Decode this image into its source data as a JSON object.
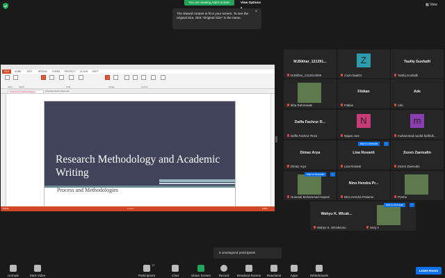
{
  "topbar": {
    "viewing": "You are viewing Ade's screen",
    "view_options": "View Options ▾",
    "view": "View",
    "notice": "The shared content is fit to your screen. To see the original size, click \"Original Size\" in the menu."
  },
  "shared": {
    "file_tab": "FILE",
    "menu_tabs": [
      "HOME",
      "EDIT",
      "REVIEW",
      "FORMS",
      "PROTECT",
      "CLOUD",
      "HELP"
    ],
    "ribbon_groups": [
      "Hand",
      "Select",
      "Tools",
      "Create",
      "Convert"
    ],
    "active_tab": "Process and Methodologies",
    "other_tab": "Shooting Flows Statement",
    "slide_title": "Research Methodology and Academic Writing",
    "slide_subtitle": "Process and Methodologies",
    "status_left": "8.5x11",
    "status_page": "1 of 14",
    "status_zoom": "100%"
  },
  "gallery": {
    "tiles": [
      {
        "name": "M.Bikhar_121291...",
        "label": "M.Bikhar_1212913006"
      },
      {
        "avatar": "Z",
        "avatar_color": "#2b9cad",
        "label": "zoom baal04"
      },
      {
        "name": "Taufiq Gusfadli",
        "label": "Taufiq Gusfadli"
      },
      {
        "label": "Ikha Rahmawati",
        "photo": true
      },
      {
        "name": "Fitdian",
        "label": "Fitdian"
      },
      {
        "name": "Ade",
        "label": "Ade"
      },
      {
        "name": "Daffa Fachrur R...",
        "label": "Daffa Fachrur Reza"
      },
      {
        "avatar": "N",
        "avatar_color": "#c93a78",
        "label": "Najwa Jure"
      },
      {
        "avatar": "m",
        "avatar_color": "#8a3fb0",
        "label": "muhammad naufal fadhlull..."
      },
      {
        "name": "Dimaz Arya",
        "label": "Dimaz Arya"
      },
      {
        "name": "Lisa Rosanti",
        "label": "Lisa Rosanti",
        "unmute": "Ask to Unmute"
      },
      {
        "name": "Zezen Zaenudin",
        "label": "Zezen Zaenudin"
      },
      {
        "label": "Gusnadi Mohammad Hapsal",
        "photo": true,
        "unmute": "Ask to Unmute"
      },
      {
        "name": "Nino Hendra Pr...",
        "label": "Nino Hendra Pratama"
      },
      {
        "label": "Prama",
        "photo": true
      },
      {
        "name": "Wahyu K. Wicak...",
        "label": "Wahyu K. Wicaksono"
      },
      {
        "label": "Hary A",
        "photo": true,
        "unmute": "Ask to Unmute"
      }
    ],
    "unassigned": "6 unassigned participants"
  },
  "toolbar": {
    "items": [
      {
        "label": "Unmute",
        "icon": "mic-muted-icon"
      },
      {
        "label": "Start Video",
        "icon": "video-off-icon"
      },
      {
        "label": "Participants",
        "icon": "participants-icon",
        "count": "17"
      },
      {
        "label": "Chat",
        "icon": "chat-icon"
      },
      {
        "label": "Share Screen",
        "icon": "share-screen-icon"
      },
      {
        "label": "Record",
        "icon": "record-icon"
      },
      {
        "label": "Breakout Rooms",
        "icon": "breakout-rooms-icon"
      },
      {
        "label": "Reactions",
        "icon": "reactions-icon"
      },
      {
        "label": "Apps",
        "icon": "apps-icon"
      },
      {
        "label": "Whiteboards",
        "icon": "whiteboard-icon"
      }
    ],
    "leave": "Leave Room"
  },
  "colors": {
    "accent": "#0e72ed",
    "share_green": "#23a45a",
    "pdf_red": "#d24726"
  }
}
